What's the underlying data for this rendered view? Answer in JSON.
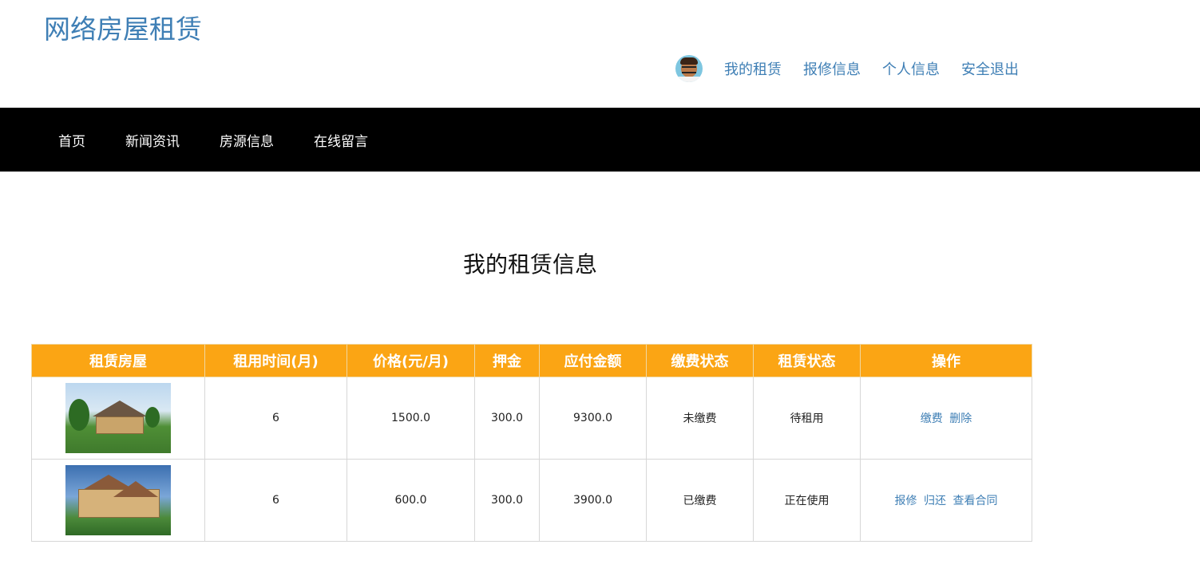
{
  "header": {
    "site_title": "网络房屋租赁",
    "user_menu": [
      "我的租赁",
      "报修信息",
      "个人信息",
      "安全退出"
    ]
  },
  "navbar": {
    "items": [
      "首页",
      "新闻资讯",
      "房源信息",
      "在线留言"
    ]
  },
  "main": {
    "title": "我的租赁信息",
    "table": {
      "headers": [
        "租赁房屋",
        "租用时间(月)",
        "价格(元/月)",
        "押金",
        "应付金额",
        "缴费状态",
        "租赁状态",
        "操作"
      ],
      "rows": [
        {
          "image": "house-photo-1",
          "months": "6",
          "price": "1500.0",
          "deposit": "300.0",
          "amount": "9300.0",
          "payment_status": "未缴费",
          "lease_status": "待租用",
          "actions": [
            "缴费",
            "删除"
          ]
        },
        {
          "image": "house-photo-2",
          "months": "6",
          "price": "600.0",
          "deposit": "300.0",
          "amount": "3900.0",
          "payment_status": "已缴费",
          "lease_status": "正在使用",
          "actions": [
            "报修",
            "归还",
            "查看合同"
          ]
        }
      ]
    }
  },
  "colors": {
    "brand_blue": "#3f7fb5",
    "navbar_bg": "#000000",
    "table_header_bg": "#fba514"
  },
  "icons": {
    "avatar": "user-avatar-icon"
  }
}
